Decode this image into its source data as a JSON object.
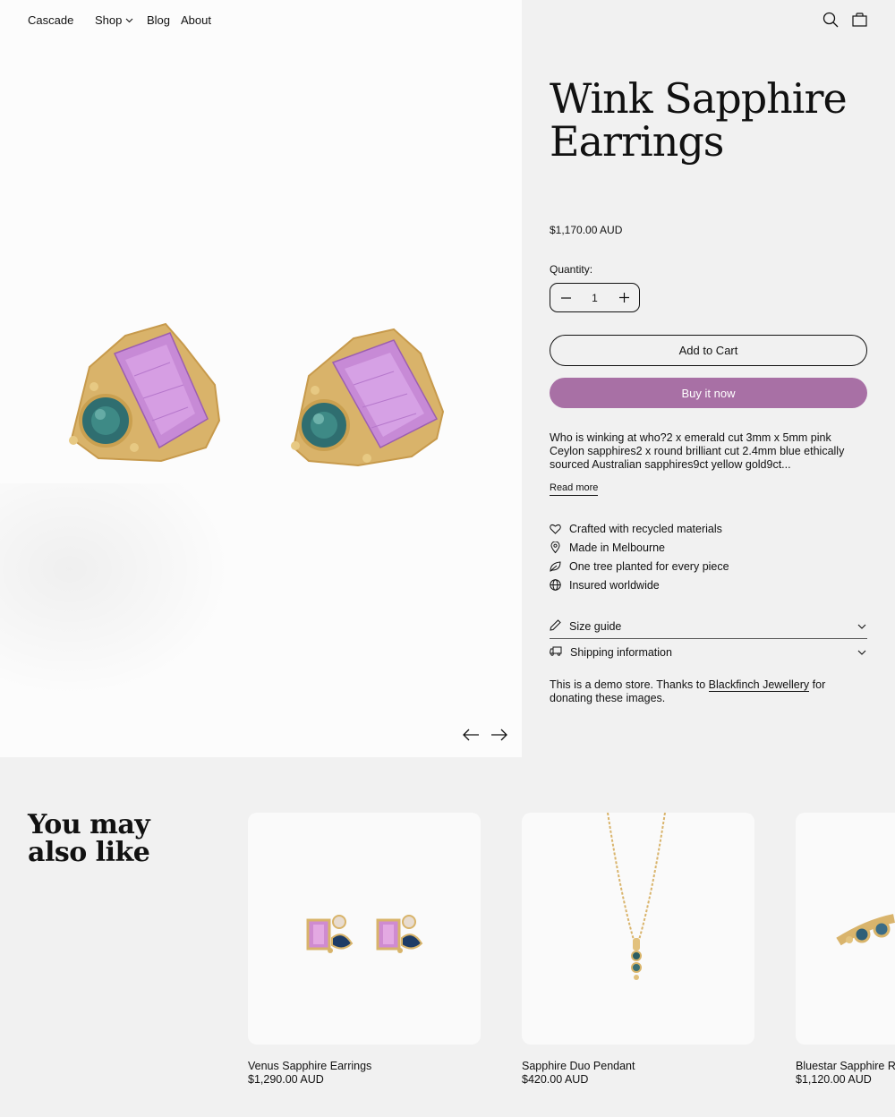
{
  "header": {
    "brand": "Cascade",
    "nav": {
      "shop": "Shop",
      "blog": "Blog",
      "about": "About"
    }
  },
  "product": {
    "title": "Wink Sapphire Earrings",
    "price": "$1,170.00 AUD",
    "quantity_label": "Quantity:",
    "quantity_value": "1",
    "add_to_cart": "Add to Cart",
    "buy_now": "Buy it now",
    "description": "Who is winking at who?2 x emerald cut 3mm x 5mm  pink Ceylon sapphires2 x round brilliant cut 2.4mm blue ethically sourced Australian sapphires9ct yellow gold9ct...",
    "read_more": "Read more",
    "features": [
      {
        "icon": "heart-icon",
        "label": "Crafted with recycled materials"
      },
      {
        "icon": "location-pin-icon",
        "label": "Made in Melbourne"
      },
      {
        "icon": "leaf-icon",
        "label": "One tree planted for every piece"
      },
      {
        "icon": "globe-icon",
        "label": "Insured worldwide"
      }
    ],
    "accordions": {
      "size_guide": "Size guide",
      "shipping": "Shipping information"
    },
    "note": {
      "prefix": "This is a demo store. Thanks to ",
      "link": "Blackfinch Jewellery",
      "suffix": " for donating these images."
    }
  },
  "related": {
    "title": "You may also like",
    "items": [
      {
        "name": "Venus Sapphire Earrings",
        "price": "$1,290.00 AUD"
      },
      {
        "name": "Sapphire Duo Pendant",
        "price": "$420.00 AUD"
      },
      {
        "name": "Bluestar Sapphire R",
        "price": "$1,120.00 AUD"
      }
    ]
  },
  "colors": {
    "accent": "#a870a5",
    "background": "#f1f1f1",
    "text": "#111111"
  }
}
